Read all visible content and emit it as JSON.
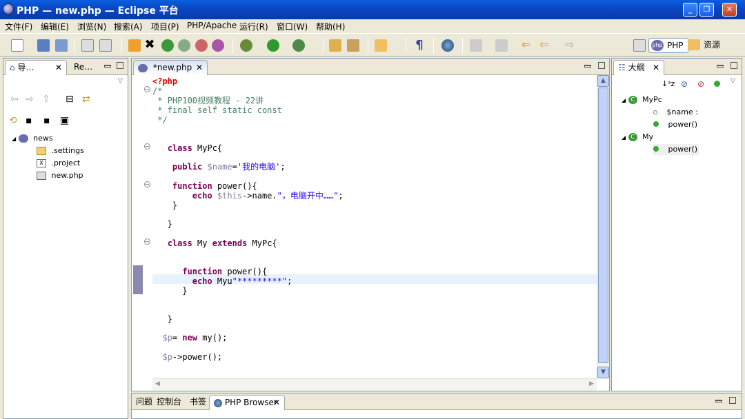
{
  "window": {
    "title": "PHP — new.php — Eclipse 平台"
  },
  "menu": [
    "文件(F)",
    "编辑(E)",
    "浏览(N)",
    "搜索(A)",
    "项目(P)",
    "PHP/Apache",
    "运行(R)",
    "窗口(W)",
    "帮助(H)"
  ],
  "perspectives": {
    "php": "PHP",
    "resource": "资源"
  },
  "left_panel": {
    "tab_navigator": "导…",
    "tab_other": "Re…",
    "tree": [
      {
        "label": "news",
        "icon": "project-icon"
      },
      {
        "label": ".settings",
        "icon": "folder-icon"
      },
      {
        "label": ".project",
        "icon": "xml-file-icon"
      },
      {
        "label": "new.php",
        "icon": "php-file-icon"
      }
    ]
  },
  "editor": {
    "tab_label": "*new.php",
    "code": [
      "<?php",
      "/*",
      " * PHP100视频教程 - 22讲",
      " * final self static const",
      " */",
      "",
      "   class MyPc{",
      "",
      "    public $name='我的电脑';",
      "",
      "    function power(){",
      "        echo $this->name.\"，电脑开中……\";",
      "    }",
      "",
      "   }",
      "",
      "   class My extends MyPc{",
      "",
      "",
      "      function power(){",
      "        echo Myu\"*********\";",
      "      }",
      "",
      "",
      "",
      "   }",
      "",
      "  $p= new my();",
      "",
      "  $p->power();"
    ]
  },
  "outline": {
    "tab_label": "大纲",
    "items": [
      {
        "label": "MyPc",
        "kind": "class"
      },
      {
        "label": "$name :",
        "kind": "field"
      },
      {
        "label": "power()",
        "kind": "method"
      },
      {
        "label": "My",
        "kind": "class"
      },
      {
        "label": "power()",
        "kind": "method"
      }
    ]
  },
  "bottom_tabs": [
    "问题",
    "控制台",
    "书签",
    "PHP Browser"
  ]
}
